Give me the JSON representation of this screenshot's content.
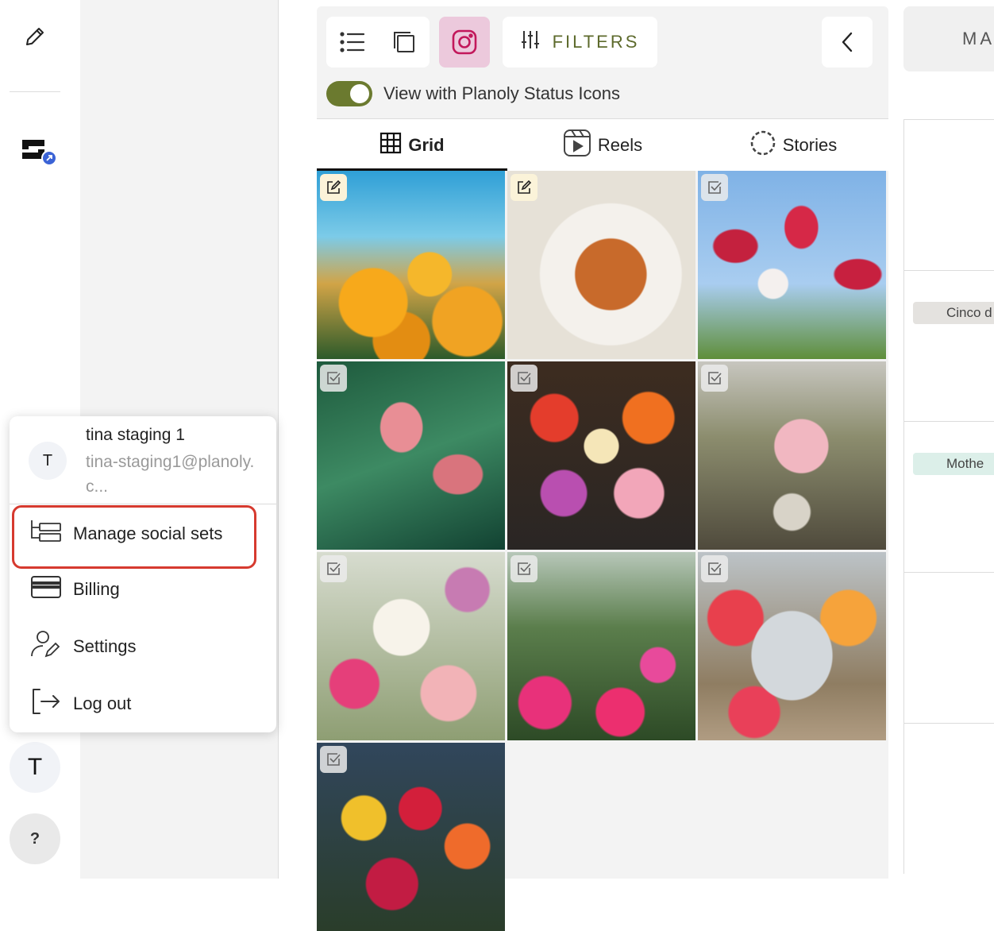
{
  "toolbar": {
    "filters_label": "FILTERS"
  },
  "toggle": {
    "label": "View with Planoly Status Icons",
    "on": true
  },
  "tabs": [
    {
      "label": "Grid",
      "active": true
    },
    {
      "label": "Reels",
      "active": false
    },
    {
      "label": "Stories",
      "active": false
    }
  ],
  "grid_tiles": [
    {
      "subject": "orange poppies",
      "status": "edit"
    },
    {
      "subject": "spaghetti plate",
      "status": "edit"
    },
    {
      "subject": "red and white tulips",
      "status": "check"
    },
    {
      "subject": "pink calla lilies",
      "status": "check"
    },
    {
      "subject": "tulip market buckets",
      "status": "check"
    },
    {
      "subject": "wedding flower urn",
      "status": "check"
    },
    {
      "subject": "rose bouquet",
      "status": "check"
    },
    {
      "subject": "tulip garden",
      "status": "check"
    },
    {
      "subject": "floral wedding arch",
      "status": "check"
    },
    {
      "subject": "mixed flower bouquet",
      "status": "check"
    }
  ],
  "calendar": {
    "month_label": "MA",
    "events": [
      "Cinco d",
      "Mothe"
    ]
  },
  "menu": {
    "user_initial": "T",
    "user_name": "tina staging 1",
    "user_email": "tina-staging1@planoly.c...",
    "items": [
      {
        "label": "Manage social sets",
        "icon": "social-sets-icon"
      },
      {
        "label": "Billing",
        "icon": "credit-card-icon"
      },
      {
        "label": "Settings",
        "icon": "user-settings-icon"
      },
      {
        "label": "Log out",
        "icon": "logout-icon"
      }
    ]
  },
  "rail": {
    "avatar_initial": "T",
    "help_label": "?"
  },
  "colors": {
    "accent_olive": "#6b7a2f",
    "instagram_pink": "#ecc9dc",
    "highlight_red": "#d63a2f"
  }
}
